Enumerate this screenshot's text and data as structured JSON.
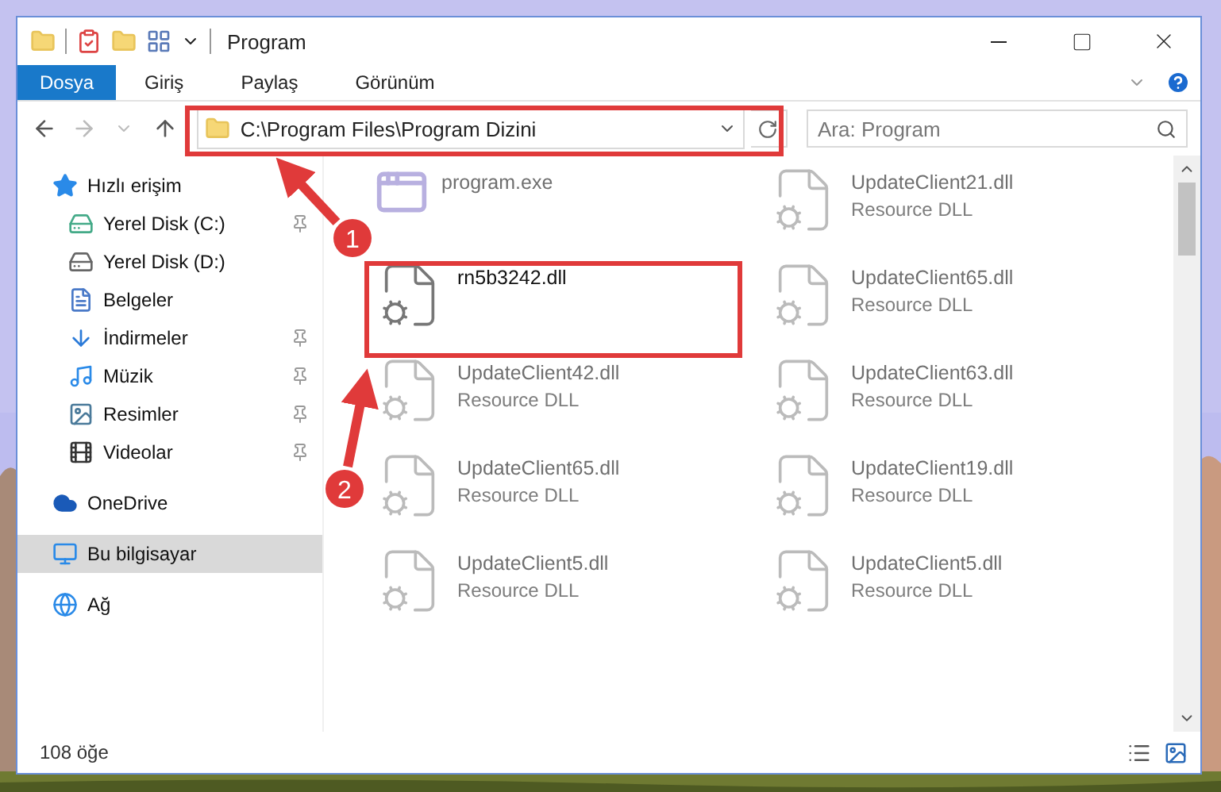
{
  "window": {
    "title": "Program"
  },
  "ribbon": {
    "tabs": [
      {
        "label": "Dosya",
        "kind": "file"
      },
      {
        "label": "Giriş",
        "kind": "tab"
      },
      {
        "label": "Paylaş",
        "kind": "tab"
      },
      {
        "label": "Görünüm",
        "kind": "tab"
      }
    ]
  },
  "address": {
    "path": "C:\\Program Files\\Program Dizini"
  },
  "search": {
    "placeholder": "Ara: Program"
  },
  "sidebar": {
    "items": [
      {
        "label": "Hızlı erişim",
        "selected": false,
        "children": [
          {
            "label": "Yerel Disk (C:)",
            "pinned": true
          },
          {
            "label": "Yerel Disk (D:)",
            "pinned": false
          },
          {
            "label": "Belgeler",
            "pinned": false
          },
          {
            "label": "İndirmeler",
            "pinned": true
          },
          {
            "label": "Müzik",
            "pinned": true
          },
          {
            "label": "Resimler",
            "pinned": true
          },
          {
            "label": "Videolar",
            "pinned": true
          }
        ]
      },
      {
        "label": "OneDrive",
        "selected": false
      },
      {
        "label": "Bu bilgisayar",
        "selected": true
      },
      {
        "label": "Ağ",
        "selected": false
      }
    ]
  },
  "files": [
    {
      "name": "program.exe",
      "kind": "exe",
      "faded": true
    },
    {
      "name": "UpdateClient21.dll",
      "type": "Resource DLL",
      "kind": "dll",
      "faded": true
    },
    {
      "name": "rn5b3242.dll",
      "kind": "dll",
      "faded": false
    },
    {
      "name": "UpdateClient65.dll",
      "type": "Resource DLL",
      "kind": "dll",
      "faded": true
    },
    {
      "name": "UpdateClient42.dll",
      "type": "Resource DLL",
      "kind": "dll",
      "faded": true
    },
    {
      "name": "UpdateClient63.dll",
      "type": "Resource DLL",
      "kind": "dll",
      "faded": true
    },
    {
      "name": "UpdateClient65.dll",
      "type": "Resource DLL",
      "kind": "dll",
      "faded": true
    },
    {
      "name": "UpdateClient19.dll",
      "type": "Resource DLL",
      "kind": "dll",
      "faded": true
    },
    {
      "name": "UpdateClient5.dll",
      "type": "Resource DLL",
      "kind": "dll",
      "faded": true
    },
    {
      "name": "UpdateClient5.dll",
      "type": "Resource DLL",
      "kind": "dll",
      "faded": true
    }
  ],
  "status_bar": {
    "item_count": "108 öğe"
  },
  "annotations": [
    {
      "number": "1"
    },
    {
      "number": "2"
    }
  ]
}
